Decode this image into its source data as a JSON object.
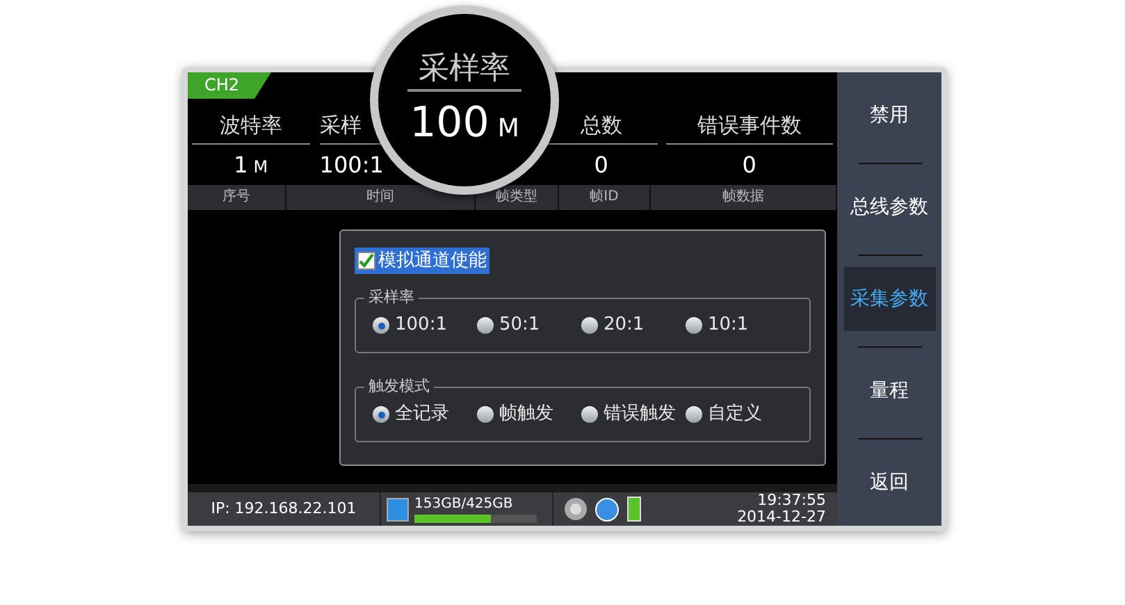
{
  "channel_tab": "CH2",
  "magnifier": {
    "label": "采样率",
    "value": "100",
    "unit": "M"
  },
  "stats": [
    {
      "label": "波特率",
      "value": "1",
      "unit": "M"
    },
    {
      "label": "采样",
      "value": "100:1"
    },
    {
      "label": "总数",
      "value": "0"
    },
    {
      "label": "错误事件数",
      "value": "0"
    }
  ],
  "table": {
    "columns": [
      "序号",
      "时间",
      "帧类型",
      "帧ID",
      "帧数据"
    ]
  },
  "dialog": {
    "checkbox": {
      "label": "模拟通道使能",
      "checked": true
    },
    "groups": [
      {
        "title": "采样率",
        "options": [
          {
            "label": "100:1",
            "selected": true
          },
          {
            "label": "50:1",
            "selected": false
          },
          {
            "label": "20:1",
            "selected": false
          },
          {
            "label": "10:1",
            "selected": false
          }
        ]
      },
      {
        "title": "触发模式",
        "options": [
          {
            "label": "全记录",
            "selected": true
          },
          {
            "label": "帧触发",
            "selected": false
          },
          {
            "label": "错误触发",
            "selected": false
          },
          {
            "label": "自定义",
            "selected": false
          }
        ]
      }
    ]
  },
  "sidebar": {
    "items": [
      {
        "label": "禁用",
        "selected": false
      },
      {
        "label": "总线参数",
        "selected": false
      },
      {
        "label": "采集参数",
        "selected": true
      },
      {
        "label": "量程",
        "selected": false
      },
      {
        "label": "返回",
        "selected": false
      }
    ]
  },
  "status_bar": {
    "ip": "IP: 192.168.22.101",
    "storage": {
      "text": "153GB/425GB",
      "level": 0.62
    },
    "time": "19:37:55",
    "date": "2014-12-27"
  }
}
